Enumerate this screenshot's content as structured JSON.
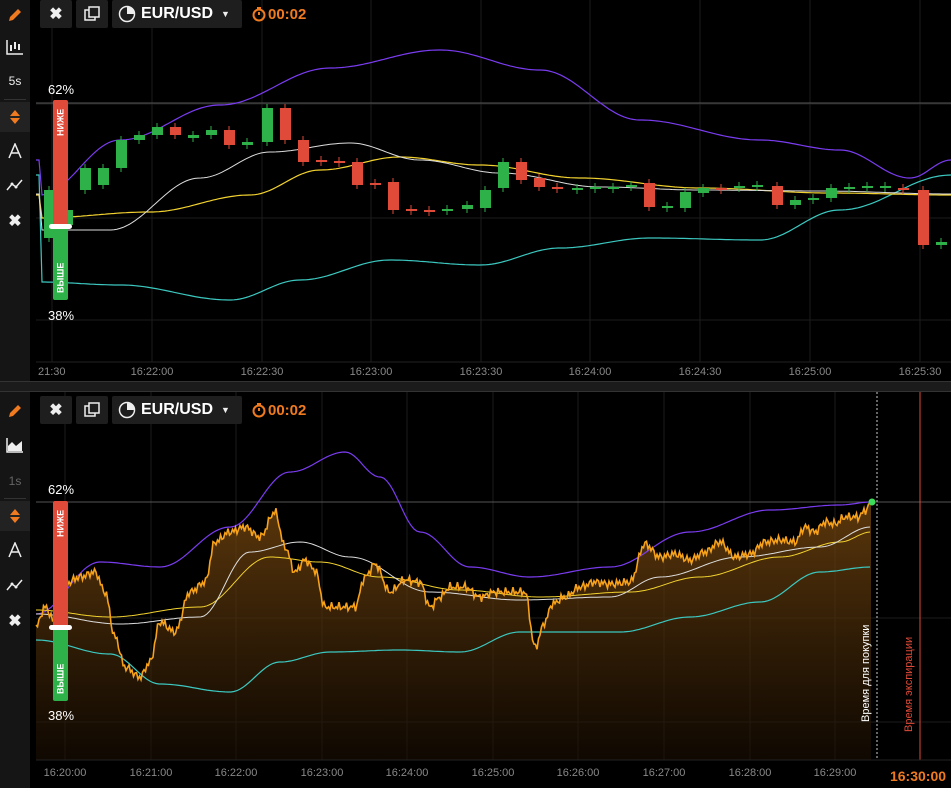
{
  "top_panel": {
    "pair": "EUR/USD",
    "timer": "00:02",
    "interval": "5s",
    "upper_pct": "62%",
    "lower_pct": "38%",
    "lower_label": "НИЖЕ",
    "higher_label": "ВЫШЕ",
    "x_ticks": [
      "21:30",
      "16:22:00",
      "16:22:30",
      "16:23:00",
      "16:23:30",
      "16:24:00",
      "16:24:30",
      "16:25:00",
      "16:25:30"
    ],
    "icons": [
      "pencil-icon",
      "candlestick-chart-icon",
      "interval",
      "up-down-icon",
      "draw-tool-icon",
      "indicator-icon",
      "close-icon"
    ]
  },
  "bottom_panel": {
    "pair": "EUR/USD",
    "timer": "00:02",
    "interval": "1s",
    "upper_pct": "62%",
    "lower_pct": "38%",
    "lower_label": "НИЖЕ",
    "higher_label": "ВЫШЕ",
    "x_ticks": [
      "16:20:00",
      "16:21:00",
      "16:22:00",
      "16:23:00",
      "16:24:00",
      "16:25:00",
      "16:26:00",
      "16:27:00",
      "16:28:00",
      "16:29:00"
    ],
    "expiry_time": "16:30:00",
    "purchase_label": "Время для покупки",
    "expiry_label": "Время экспирации",
    "icons": [
      "pencil-icon",
      "area-chart-icon",
      "interval",
      "up-down-icon",
      "draw-tool-icon",
      "indicator-icon",
      "close-icon"
    ]
  },
  "colors": {
    "accent": "#f07a20",
    "bull": "#2fb14a",
    "bear": "#e04a38",
    "upper_band": "#7a3cf0",
    "lower_band": "#3cc8c0",
    "ma_yellow": "#f2d230",
    "ma_white": "#dddddd",
    "price_line": "#f7a21a",
    "expiry_line": "#e04a38"
  }
}
